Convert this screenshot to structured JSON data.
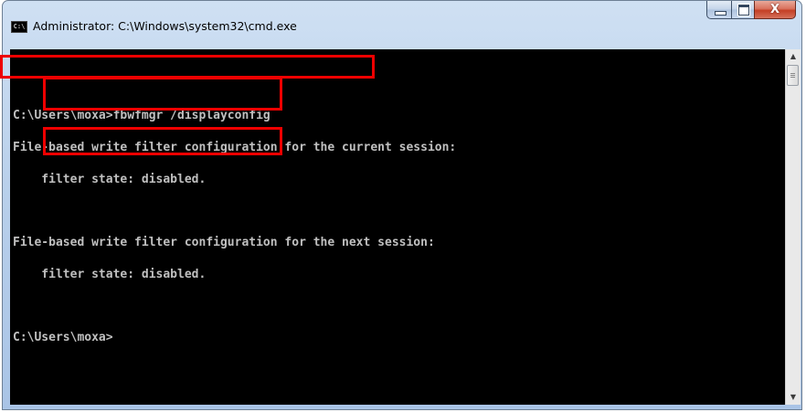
{
  "window": {
    "title": "Administrator: C:\\Windows\\system32\\cmd.exe",
    "icon": "cmd-icon",
    "icon_text": "C:\\",
    "controls": {
      "minimize_icon": "minimize-icon",
      "maximize_icon": "maximize-icon",
      "close_icon": "close-icon",
      "close_glyph": "X"
    }
  },
  "console": {
    "lines": [
      "",
      "C:\\Users\\moxa>fbwfmgr /displayconfig",
      "File-based write filter configuration for the current session:",
      "    filter state: disabled.",
      "",
      "File-based write filter configuration for the next session:",
      "    filter state: disabled.",
      "",
      "C:\\Users\\moxa>"
    ],
    "text_color": "#c0c0c0",
    "background": "#000000"
  },
  "annotations": {
    "highlight_color": "#ee0000"
  }
}
